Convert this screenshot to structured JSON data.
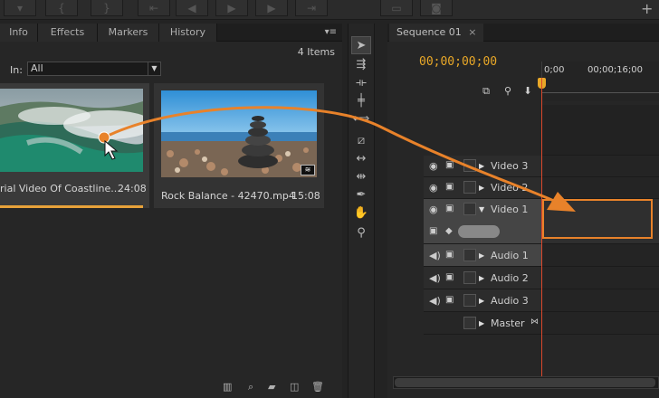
{
  "project_panel": {
    "tabs": [
      "Info",
      "Effects",
      "Markers",
      "History"
    ],
    "items_count": "4 Items",
    "filter_label": "In:",
    "filter_value": "All",
    "clips": [
      {
        "name": "rial Video Of Coastline....",
        "duration": "24:08"
      },
      {
        "name": "Rock Balance - 42470.mp4",
        "duration": "15:08"
      }
    ]
  },
  "timeline": {
    "sequence_tab": "Sequence 01",
    "close_glyph": "×",
    "timecode": "00;00;00;00",
    "ruler_labels": [
      "0;00",
      "00;00;16;00"
    ],
    "tracks": [
      {
        "name": "Video 3",
        "type": "video"
      },
      {
        "name": "Video 2",
        "type": "video"
      },
      {
        "name": "Video 1",
        "type": "video"
      },
      {
        "name": "Audio 1",
        "type": "audio"
      },
      {
        "name": "Audio 2",
        "type": "audio"
      },
      {
        "name": "Audio 3",
        "type": "audio"
      },
      {
        "name": "Master",
        "type": "master"
      }
    ]
  },
  "colors": {
    "accent": "#e9a828",
    "playhead": "#d9472b",
    "drag_arrow": "#e8822a"
  },
  "icons": [
    "pointer-icon",
    "track-select-icon",
    "ripple-edit-icon",
    "rolling-edit-icon",
    "rate-stretch-icon",
    "razor-icon",
    "slip-icon",
    "slide-icon",
    "pen-icon",
    "hand-icon",
    "zoom-icon"
  ]
}
